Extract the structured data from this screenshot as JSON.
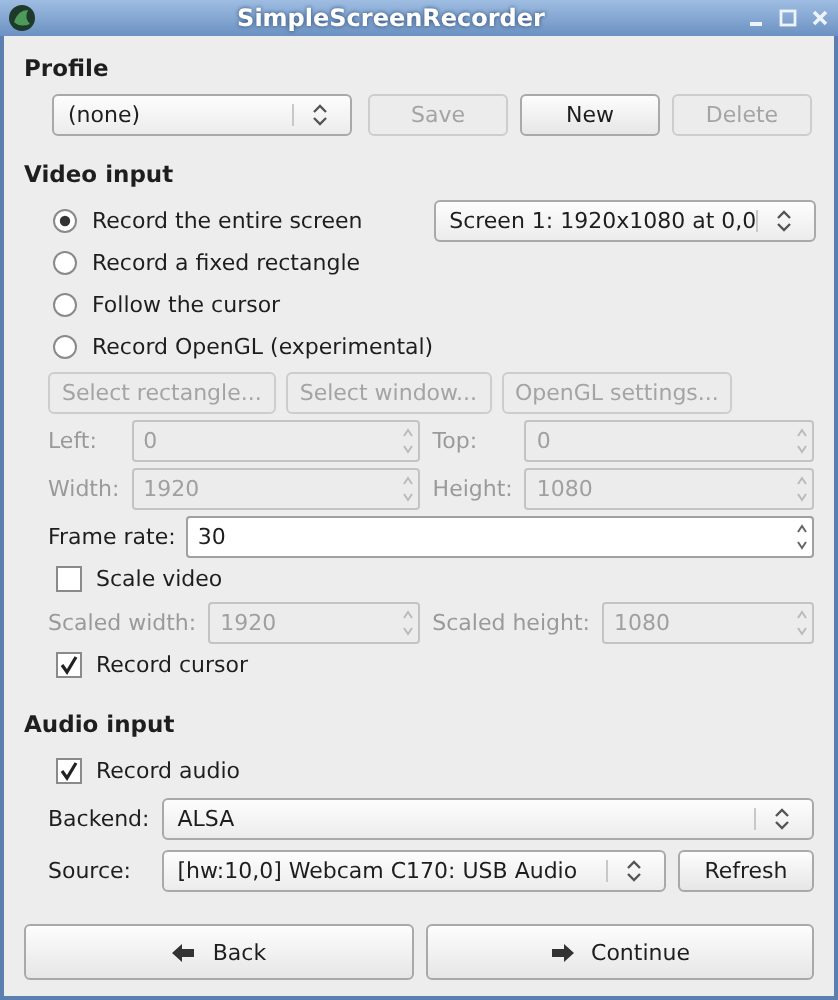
{
  "window": {
    "title": "SimpleScreenRecorder"
  },
  "profile": {
    "heading": "Profile",
    "value": "(none)",
    "buttons": [
      {
        "label": "Save",
        "disabled": true
      },
      {
        "label": "New",
        "disabled": false
      },
      {
        "label": "Delete",
        "disabled": true
      }
    ]
  },
  "video_input": {
    "heading": "Video input",
    "modes": [
      {
        "label": "Record the entire screen",
        "selected": true
      },
      {
        "label": "Record a fixed rectangle",
        "selected": false
      },
      {
        "label": "Follow the cursor",
        "selected": false
      },
      {
        "label": "Record OpenGL (experimental)",
        "selected": false
      }
    ],
    "screen": "Screen 1: 1920x1080 at 0,0",
    "buttons": [
      {
        "label": "Select rectangle...",
        "disabled": true
      },
      {
        "label": "Select window...",
        "disabled": true
      },
      {
        "label": "OpenGL settings...",
        "disabled": true
      }
    ],
    "fields": [
      {
        "label": "Left:",
        "value": "0",
        "disabled": true
      },
      {
        "label": "Top:",
        "value": "0",
        "disabled": true
      },
      {
        "label": "Width:",
        "value": "1920",
        "disabled": true
      },
      {
        "label": "Height:",
        "value": "1080",
        "disabled": true
      }
    ],
    "frame_rate": {
      "label": "Frame rate:",
      "value": "30",
      "disabled": false
    },
    "scale_video": {
      "label": "Scale video",
      "checked": false
    },
    "scaled_fields": [
      {
        "label": "Scaled width:",
        "value": "1920",
        "disabled": true
      },
      {
        "label": "Scaled height:",
        "value": "1080",
        "disabled": true
      }
    ],
    "record_cursor": {
      "label": "Record cursor",
      "checked": true
    }
  },
  "audio_input": {
    "heading": "Audio input",
    "record_audio": {
      "label": "Record audio",
      "checked": true
    },
    "backend": {
      "label": "Backend:",
      "value": "ALSA"
    },
    "source": {
      "label": "Source:",
      "value": "[hw:10,0] Webcam C170: USB Audio"
    },
    "refresh": "Refresh"
  },
  "nav": [
    {
      "label": "Back",
      "kind": "back"
    },
    {
      "label": "Continue",
      "kind": "continue"
    }
  ]
}
